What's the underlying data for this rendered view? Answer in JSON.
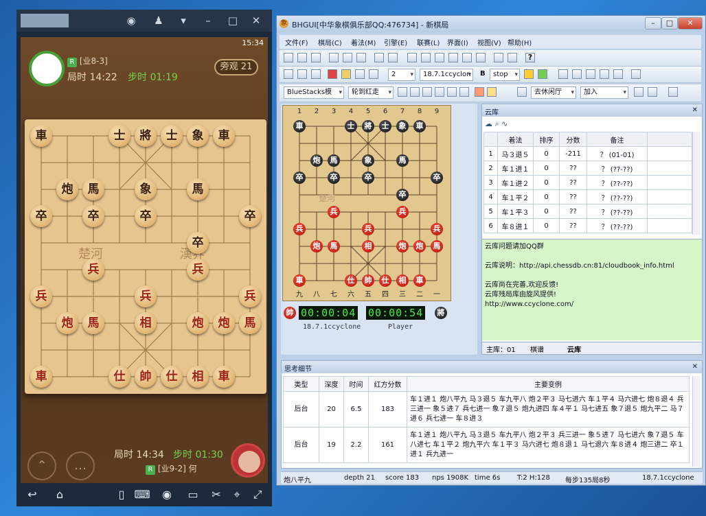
{
  "emulator": {
    "time": "15:34",
    "top_player": {
      "rank": "[业8-3]",
      "total_time": "局时 14:22",
      "step_time": "步时 01:19",
      "rating_tag": "R"
    },
    "watch_label": "旁观",
    "watch_count": "21",
    "river_left": "楚河",
    "river_right": "漢界",
    "bottom_player": {
      "rank": "[业9-2] 何",
      "total_time": "局时 14:34",
      "step_time": "步时 01:30",
      "rating_tag": "R"
    },
    "big_board": [
      {
        "t": "車",
        "s": "dk",
        "c": 0,
        "r": 0
      },
      {
        "t": "士",
        "s": "dk",
        "c": 3,
        "r": 0
      },
      {
        "t": "將",
        "s": "dk",
        "c": 4,
        "r": 0
      },
      {
        "t": "士",
        "s": "dk",
        "c": 5,
        "r": 0
      },
      {
        "t": "象",
        "s": "dk",
        "c": 6,
        "r": 0
      },
      {
        "t": "車",
        "s": "dk",
        "c": 7,
        "r": 0
      },
      {
        "t": "炮",
        "s": "dk",
        "c": 1,
        "r": 2
      },
      {
        "t": "馬",
        "s": "dk",
        "c": 2,
        "r": 2
      },
      {
        "t": "象",
        "s": "dk",
        "c": 4,
        "r": 2
      },
      {
        "t": "馬",
        "s": "dk",
        "c": 6,
        "r": 2
      },
      {
        "t": "卒",
        "s": "dk",
        "c": 0,
        "r": 3
      },
      {
        "t": "卒",
        "s": "dk",
        "c": 2,
        "r": 3
      },
      {
        "t": "卒",
        "s": "dk",
        "c": 4,
        "r": 3
      },
      {
        "t": "卒",
        "s": "dk",
        "c": 8,
        "r": 3
      },
      {
        "t": "卒",
        "s": "dk",
        "c": 6,
        "r": 4
      },
      {
        "t": "兵",
        "s": "rd",
        "c": 2,
        "r": 5
      },
      {
        "t": "兵",
        "s": "rd",
        "c": 6,
        "r": 5
      },
      {
        "t": "兵",
        "s": "rd",
        "c": 0,
        "r": 6
      },
      {
        "t": "兵",
        "s": "rd",
        "c": 4,
        "r": 6
      },
      {
        "t": "兵",
        "s": "rd",
        "c": 8,
        "r": 6
      },
      {
        "t": "炮",
        "s": "rd",
        "c": 1,
        "r": 7
      },
      {
        "t": "馬",
        "s": "rd",
        "c": 2,
        "r": 7
      },
      {
        "t": "相",
        "s": "rd",
        "c": 4,
        "r": 7
      },
      {
        "t": "炮",
        "s": "rd",
        "c": 6,
        "r": 7
      },
      {
        "t": "炮",
        "s": "rd",
        "c": 7,
        "r": 7
      },
      {
        "t": "馬",
        "s": "rd",
        "c": 8,
        "r": 7
      },
      {
        "t": "車",
        "s": "rd",
        "c": 0,
        "r": 9
      },
      {
        "t": "仕",
        "s": "rd",
        "c": 3,
        "r": 9
      },
      {
        "t": "帥",
        "s": "rd",
        "c": 4,
        "r": 9
      },
      {
        "t": "仕",
        "s": "rd",
        "c": 5,
        "r": 9
      },
      {
        "t": "相",
        "s": "rd",
        "c": 6,
        "r": 9
      },
      {
        "t": "車",
        "s": "rd",
        "c": 7,
        "r": 9
      }
    ]
  },
  "window": {
    "title": "BHGUI[中华象棋俱乐部QQ:476734] - 新棋局",
    "logo": "象",
    "menu": [
      "文件(F)",
      "棋局(C)",
      "着法(M)",
      "引擎(E)",
      "联赛(L)",
      "界面(I)",
      "视图(V)",
      "帮助(H)"
    ],
    "toolbar2": {
      "depth": "2",
      "engine": "18.7.1ccyclon",
      "B": "B",
      "stop": "stop"
    },
    "toolbar3": {
      "source": "BlueStacks模",
      "turn": "轮到红走",
      "mode": "去休闲厅",
      "join": "加入"
    },
    "file_labels": [
      "1",
      "2",
      "3",
      "4",
      "5",
      "6",
      "7",
      "8",
      "9"
    ],
    "rank_labels": [
      "九",
      "八",
      "七",
      "六",
      "五",
      "四",
      "三",
      "二",
      "一"
    ],
    "small_board": [
      {
        "t": "車",
        "s": "bk",
        "c": 0,
        "r": 0
      },
      {
        "t": "士",
        "s": "bk",
        "c": 3,
        "r": 0
      },
      {
        "t": "將",
        "s": "bk",
        "c": 4,
        "r": 0
      },
      {
        "t": "士",
        "s": "bk",
        "c": 5,
        "r": 0
      },
      {
        "t": "象",
        "s": "bk",
        "c": 6,
        "r": 0
      },
      {
        "t": "車",
        "s": "bk",
        "c": 7,
        "r": 0
      },
      {
        "t": "炮",
        "s": "bk",
        "c": 1,
        "r": 2
      },
      {
        "t": "馬",
        "s": "bk",
        "c": 2,
        "r": 2
      },
      {
        "t": "象",
        "s": "bk",
        "c": 4,
        "r": 2
      },
      {
        "t": "馬",
        "s": "bk",
        "c": 6,
        "r": 2
      },
      {
        "t": "卒",
        "s": "bk",
        "c": 0,
        "r": 3
      },
      {
        "t": "卒",
        "s": "bk",
        "c": 2,
        "r": 3
      },
      {
        "t": "卒",
        "s": "bk",
        "c": 4,
        "r": 3
      },
      {
        "t": "卒",
        "s": "bk",
        "c": 8,
        "r": 3
      },
      {
        "t": "卒",
        "s": "bk",
        "c": 6,
        "r": 4
      },
      {
        "t": "兵",
        "s": "rd",
        "c": 2,
        "r": 5
      },
      {
        "t": "兵",
        "s": "rd",
        "c": 6,
        "r": 5
      },
      {
        "t": "兵",
        "s": "rd",
        "c": 0,
        "r": 6
      },
      {
        "t": "兵",
        "s": "rd",
        "c": 4,
        "r": 6
      },
      {
        "t": "兵",
        "s": "rd",
        "c": 8,
        "r": 6
      },
      {
        "t": "炮",
        "s": "rd",
        "c": 1,
        "r": 7
      },
      {
        "t": "馬",
        "s": "rd",
        "c": 2,
        "r": 7
      },
      {
        "t": "相",
        "s": "rd",
        "c": 4,
        "r": 7
      },
      {
        "t": "炮",
        "s": "rd",
        "c": 6,
        "r": 7
      },
      {
        "t": "炮",
        "s": "rd",
        "c": 7,
        "r": 7
      },
      {
        "t": "馬",
        "s": "rd",
        "c": 8,
        "r": 7
      },
      {
        "t": "車",
        "s": "rd",
        "c": 0,
        "r": 9
      },
      {
        "t": "仕",
        "s": "rd",
        "c": 3,
        "r": 9
      },
      {
        "t": "帥",
        "s": "rd",
        "c": 4,
        "r": 9
      },
      {
        "t": "仕",
        "s": "rd",
        "c": 5,
        "r": 9
      },
      {
        "t": "相",
        "s": "rd",
        "c": 6,
        "r": 9
      },
      {
        "t": "車",
        "s": "rd",
        "c": 7,
        "r": 9
      }
    ],
    "river_small": "楚河",
    "red_side": "帥",
    "black_side": "將",
    "red_clock": "00:00:04",
    "black_clock": "00:00:54",
    "red_name": "18.7.1ccyclone",
    "black_name": "Player",
    "cloud": {
      "title": "云库",
      "headers": [
        "",
        "着法",
        "排序",
        "分数",
        "备注"
      ],
      "rows": [
        [
          "1",
          "马３退５",
          "0",
          "-211",
          "？ (01-01)"
        ],
        [
          "2",
          "车１进１",
          "0",
          "??",
          "？ (??-??)"
        ],
        [
          "3",
          "车１进２",
          "0",
          "??",
          "？ (??-??)"
        ],
        [
          "4",
          "车１平２",
          "0",
          "??",
          "？ (??-??)"
        ],
        [
          "5",
          "车１平３",
          "0",
          "??",
          "？ (??-??)"
        ],
        [
          "6",
          "车８进１",
          "0",
          "??",
          "？ (??-??)"
        ]
      ],
      "info": [
        "云库问题请加QQ群",
        "云库说明：http://api.chessdb.cn:81/cloudbook_info.html",
        "云库尚在完善,欢迎反馈!",
        "云库残局库由旋风提供!",
        "http://www.ccyclone.com/"
      ],
      "tabs": [
        "主库：01",
        "棋谱",
        "云库"
      ]
    },
    "analysis": {
      "title": "思考细节",
      "headers": [
        "类型",
        "深度",
        "时间",
        "红方分数",
        "主要变例"
      ],
      "rows": [
        [
          "后台",
          "20",
          "6.5",
          "183",
          "车１进１ 炮八平九 马３退５ 车九平八 炮２平３ 马七进六 车１平４ 马六进七 炮８退４ 兵三进一 象５进７ 兵七进一 象７退５ 炮九进四 车４平１ 马七进五 象７退５ 炮九平二 马７进６ 兵七进一 车８进３"
        ],
        [
          "后台",
          "19",
          "2.2",
          "161",
          "车１进１ 炮八平九 马３退５ 车九平八 炮２平３ 兵三进一 象５进７ 马七进六 象７退５ 车八进七 车１平２ 炮九平六 车１平３ 马六进七 炮８退１ 马七退六 车８进４ 炮三进二 卒１进１ 兵九进一"
        ]
      ]
    },
    "status": {
      "move": "炮八平九",
      "depth": "depth 21",
      "score": "score 183",
      "nps": "nps 1908K",
      "time": "time 6s",
      "tbl": "T:2 H:128",
      "rate": "每步135局8秒",
      "engine": "18.7.1ccyclone"
    }
  }
}
